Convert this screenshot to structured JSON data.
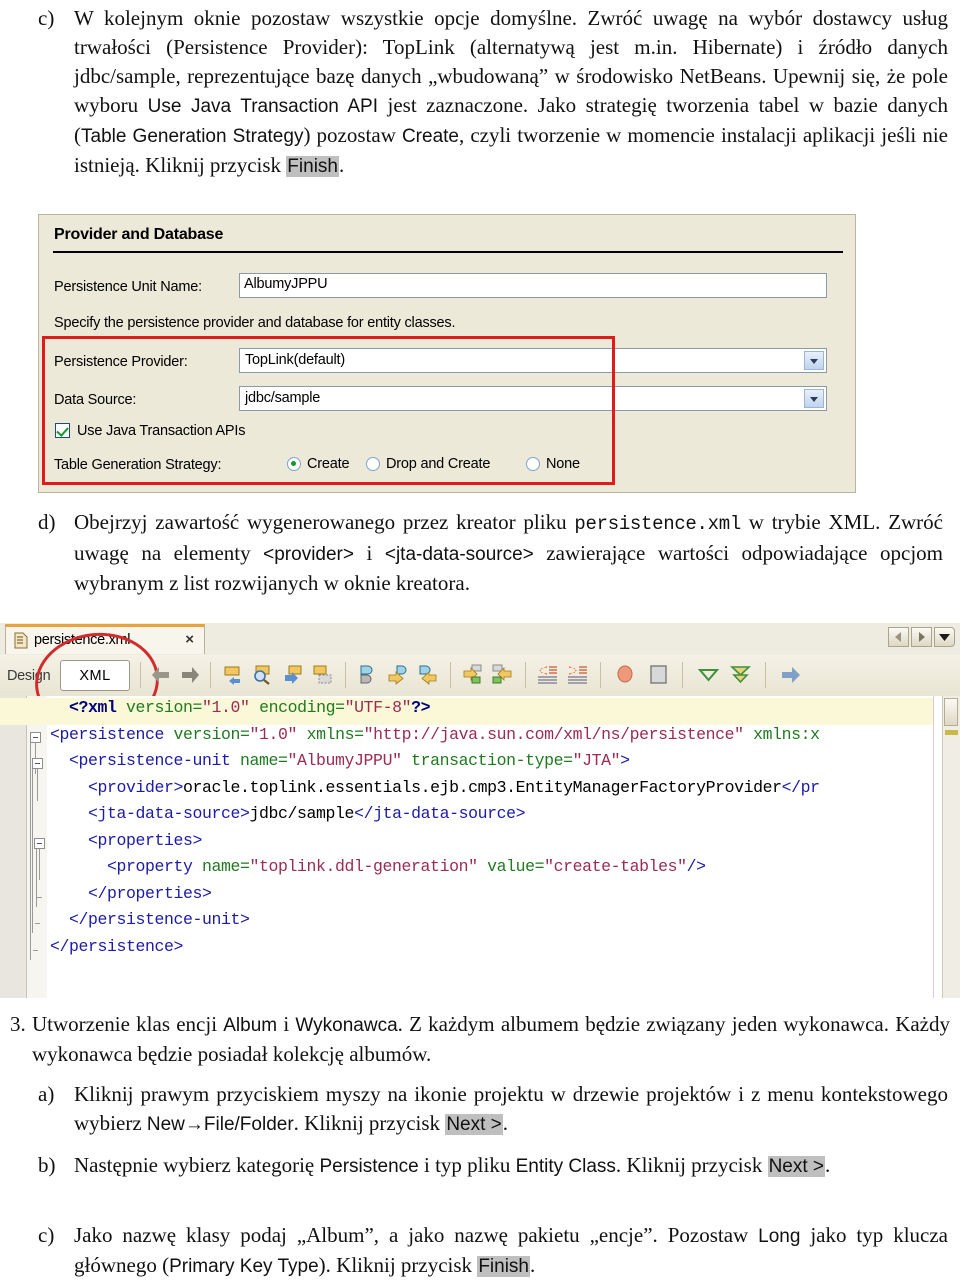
{
  "document": {
    "paragraph_c": {
      "marker": "c)",
      "t1": "W kolejnym oknie pozostaw wszystkie opcje domyślne. Zwróć uwagę na wybór dostawcy usług trwałości (Persistence Provider): TopLink (alternatywą jest m.in. Hibernate) i źródło danych jdbc/sample, reprezentujące bazę danych „wbudowaną” w środowisko NetBeans. Upewnij się, że pole wyboru ",
      "t2": "Use Java Transaction API",
      "t3": " jest zaznaczone. Jako strategię tworzenia tabel w bazie danych (",
      "t4": "Table Generation Strategy",
      "t5": ") pozostaw ",
      "t6": "Create",
      "t7": ", czyli tworzenie w momencie instalacji aplikacji jeśli nie istnieją. Kliknij przycisk ",
      "t8": "Finish",
      "t9": "."
    },
    "paragraph_d": {
      "marker": "d)",
      "t1": "Obejrzyj zawartość wygenerowanego przez kreator pliku ",
      "t2": "persistence.xml",
      "t3": " w trybie XML. Zwróć uwagę na elementy ",
      "t4": "<provider>",
      "t5": " i ",
      "t6": "<jta-data-source>",
      "t7": " zawierające wartości odpowiadające opcjom wybranym z list rozwijanych w oknie kreatora."
    },
    "section_3": {
      "marker": "3.",
      "t1": "Utworzenie klas encji ",
      "t2": "Album",
      "t3": " i ",
      "t4": "Wykonawca",
      "t5": ". Z każdym albumem będzie związany jeden wykonawca. Każdy wykonawca będzie posiadał kolekcję albumów."
    },
    "item_a": {
      "marker": "a)",
      "t1": "Kliknij prawym przyciskiem myszy na ikonie projektu w drzewie projektów i z menu kontekstowego wybierz ",
      "t2": "New→File/Folder",
      "t3": ". Kliknij przycisk ",
      "t4": "Next >",
      "t5": "."
    },
    "item_b": {
      "marker": "b)",
      "t1": "Następnie wybierz kategorię ",
      "t2": "Persistence",
      "t3": " i typ pliku ",
      "t4": "Entity Class",
      "t5": ". Kliknij przycisk ",
      "t6": "Next >",
      "t7": "."
    },
    "item_c": {
      "marker": "c)",
      "t1": "Jako nazwę klasy podaj „Album”, a jako nazwę pakietu „encje”. Pozostaw ",
      "t2": "Long",
      "t3": " jako typ klucza głównego (",
      "t4": "Primary Key Type",
      "t5": "). Kliknij przycisk ",
      "t6": "Finish",
      "t7": "."
    }
  },
  "wizard": {
    "section_title": "Provider and Database",
    "unit_name_label": "Persistence Unit Name:",
    "unit_name_value": "AlbumyJPPU",
    "hint_text": "Specify the persistence provider and database for entity classes.",
    "provider_label": "Persistence Provider:",
    "provider_value": "TopLink(default)",
    "datasource_label": "Data Source:",
    "datasource_value": "jdbc/sample",
    "jta_checkbox_label": "Use Java Transaction APIs",
    "jta_checked": true,
    "strategy_label": "Table Generation Strategy:",
    "strategy_options": [
      "Create",
      "Drop and Create",
      "None"
    ],
    "strategy_selected": "Create",
    "highlight_color": "#e01b1b",
    "dialog_bg": "#ece9d8"
  },
  "editor": {
    "file_tab_label": "persistence.xml",
    "close_label": "×",
    "design_tab_label": "Design",
    "xml_tab_label": "XML",
    "annotation_color": "#d22b2b",
    "toolbar_icons": [
      "back-arrow-icon",
      "forward-arrow-icon",
      "insert-element-icon",
      "find-element-icon",
      "go-to-element-icon",
      "duplicate-element-icon",
      "add-attribute-icon",
      "insert-attribute-icon",
      "remove-attribute-icon",
      "add-child-icon",
      "add-sibling-icon",
      "shift-left-icon",
      "shift-right-icon",
      "toggle-breakpoint-icon",
      "stop-icon",
      "collapse-all-icon",
      "expand-all-icon",
      "next-error-icon"
    ],
    "nav_buttons": [
      "scroll-left-icon",
      "scroll-right-icon",
      "tab-list-icon"
    ],
    "code_lines": [
      {
        "indent": 1,
        "current": true,
        "fold": "none",
        "tokens": [
          {
            "t": "<?",
            "c": "pi"
          },
          {
            "t": "xml",
            "c": "pi"
          },
          {
            "t": " version=",
            "c": "at"
          },
          {
            "t": "\"1.0\"",
            "c": "vl"
          },
          {
            "t": " encoding=",
            "c": "at"
          },
          {
            "t": "\"UTF-8\"",
            "c": "vl"
          },
          {
            "t": "?>",
            "c": "pi"
          }
        ]
      },
      {
        "indent": 0,
        "current": false,
        "fold": "open",
        "tokens": [
          {
            "t": "<persistence",
            "c": "tg"
          },
          {
            "t": " version=",
            "c": "at"
          },
          {
            "t": "\"1.0\"",
            "c": "vl"
          },
          {
            "t": " xmlns=",
            "c": "at"
          },
          {
            "t": "\"http://java.sun.com/xml/ns/persistence\"",
            "c": "vl"
          },
          {
            "t": " xmlns:x",
            "c": "at"
          }
        ]
      },
      {
        "indent": 1,
        "current": false,
        "fold": "open",
        "tokens": [
          {
            "t": "<persistence-unit",
            "c": "tg"
          },
          {
            "t": " name=",
            "c": "at"
          },
          {
            "t": "\"AlbumyJPPU\"",
            "c": "vl"
          },
          {
            "t": " transaction-type=",
            "c": "at"
          },
          {
            "t": "\"JTA\"",
            "c": "vl"
          },
          {
            "t": ">",
            "c": "tg"
          }
        ]
      },
      {
        "indent": 2,
        "current": false,
        "fold": "none",
        "tokens": [
          {
            "t": "<provider>",
            "c": "tg"
          },
          {
            "t": "oracle.toplink.essentials.ejb.cmp3.EntityManagerFactoryProvider",
            "c": "tx"
          },
          {
            "t": "</pr",
            "c": "tg"
          }
        ]
      },
      {
        "indent": 2,
        "current": false,
        "fold": "none",
        "tokens": [
          {
            "t": "<jta-data-source>",
            "c": "tg"
          },
          {
            "t": "jdbc/sample",
            "c": "tx"
          },
          {
            "t": "</jta-data-source>",
            "c": "tg"
          }
        ]
      },
      {
        "indent": 2,
        "current": false,
        "fold": "open",
        "tokens": [
          {
            "t": "<properties>",
            "c": "tg"
          }
        ]
      },
      {
        "indent": 3,
        "current": false,
        "fold": "none",
        "tokens": [
          {
            "t": "<property",
            "c": "tg"
          },
          {
            "t": " name=",
            "c": "at"
          },
          {
            "t": "\"toplink.ddl-generation\"",
            "c": "vl"
          },
          {
            "t": " value=",
            "c": "at"
          },
          {
            "t": "\"create-tables\"",
            "c": "vl"
          },
          {
            "t": "/>",
            "c": "tg"
          }
        ]
      },
      {
        "indent": 2,
        "current": false,
        "fold": "close",
        "tokens": [
          {
            "t": "</properties>",
            "c": "tg"
          }
        ]
      },
      {
        "indent": 1,
        "current": false,
        "fold": "close",
        "tokens": [
          {
            "t": "</persistence-unit>",
            "c": "tg"
          }
        ]
      },
      {
        "indent": 0,
        "current": false,
        "fold": "close",
        "tokens": [
          {
            "t": "</persistence>",
            "c": "tg"
          }
        ]
      }
    ]
  }
}
